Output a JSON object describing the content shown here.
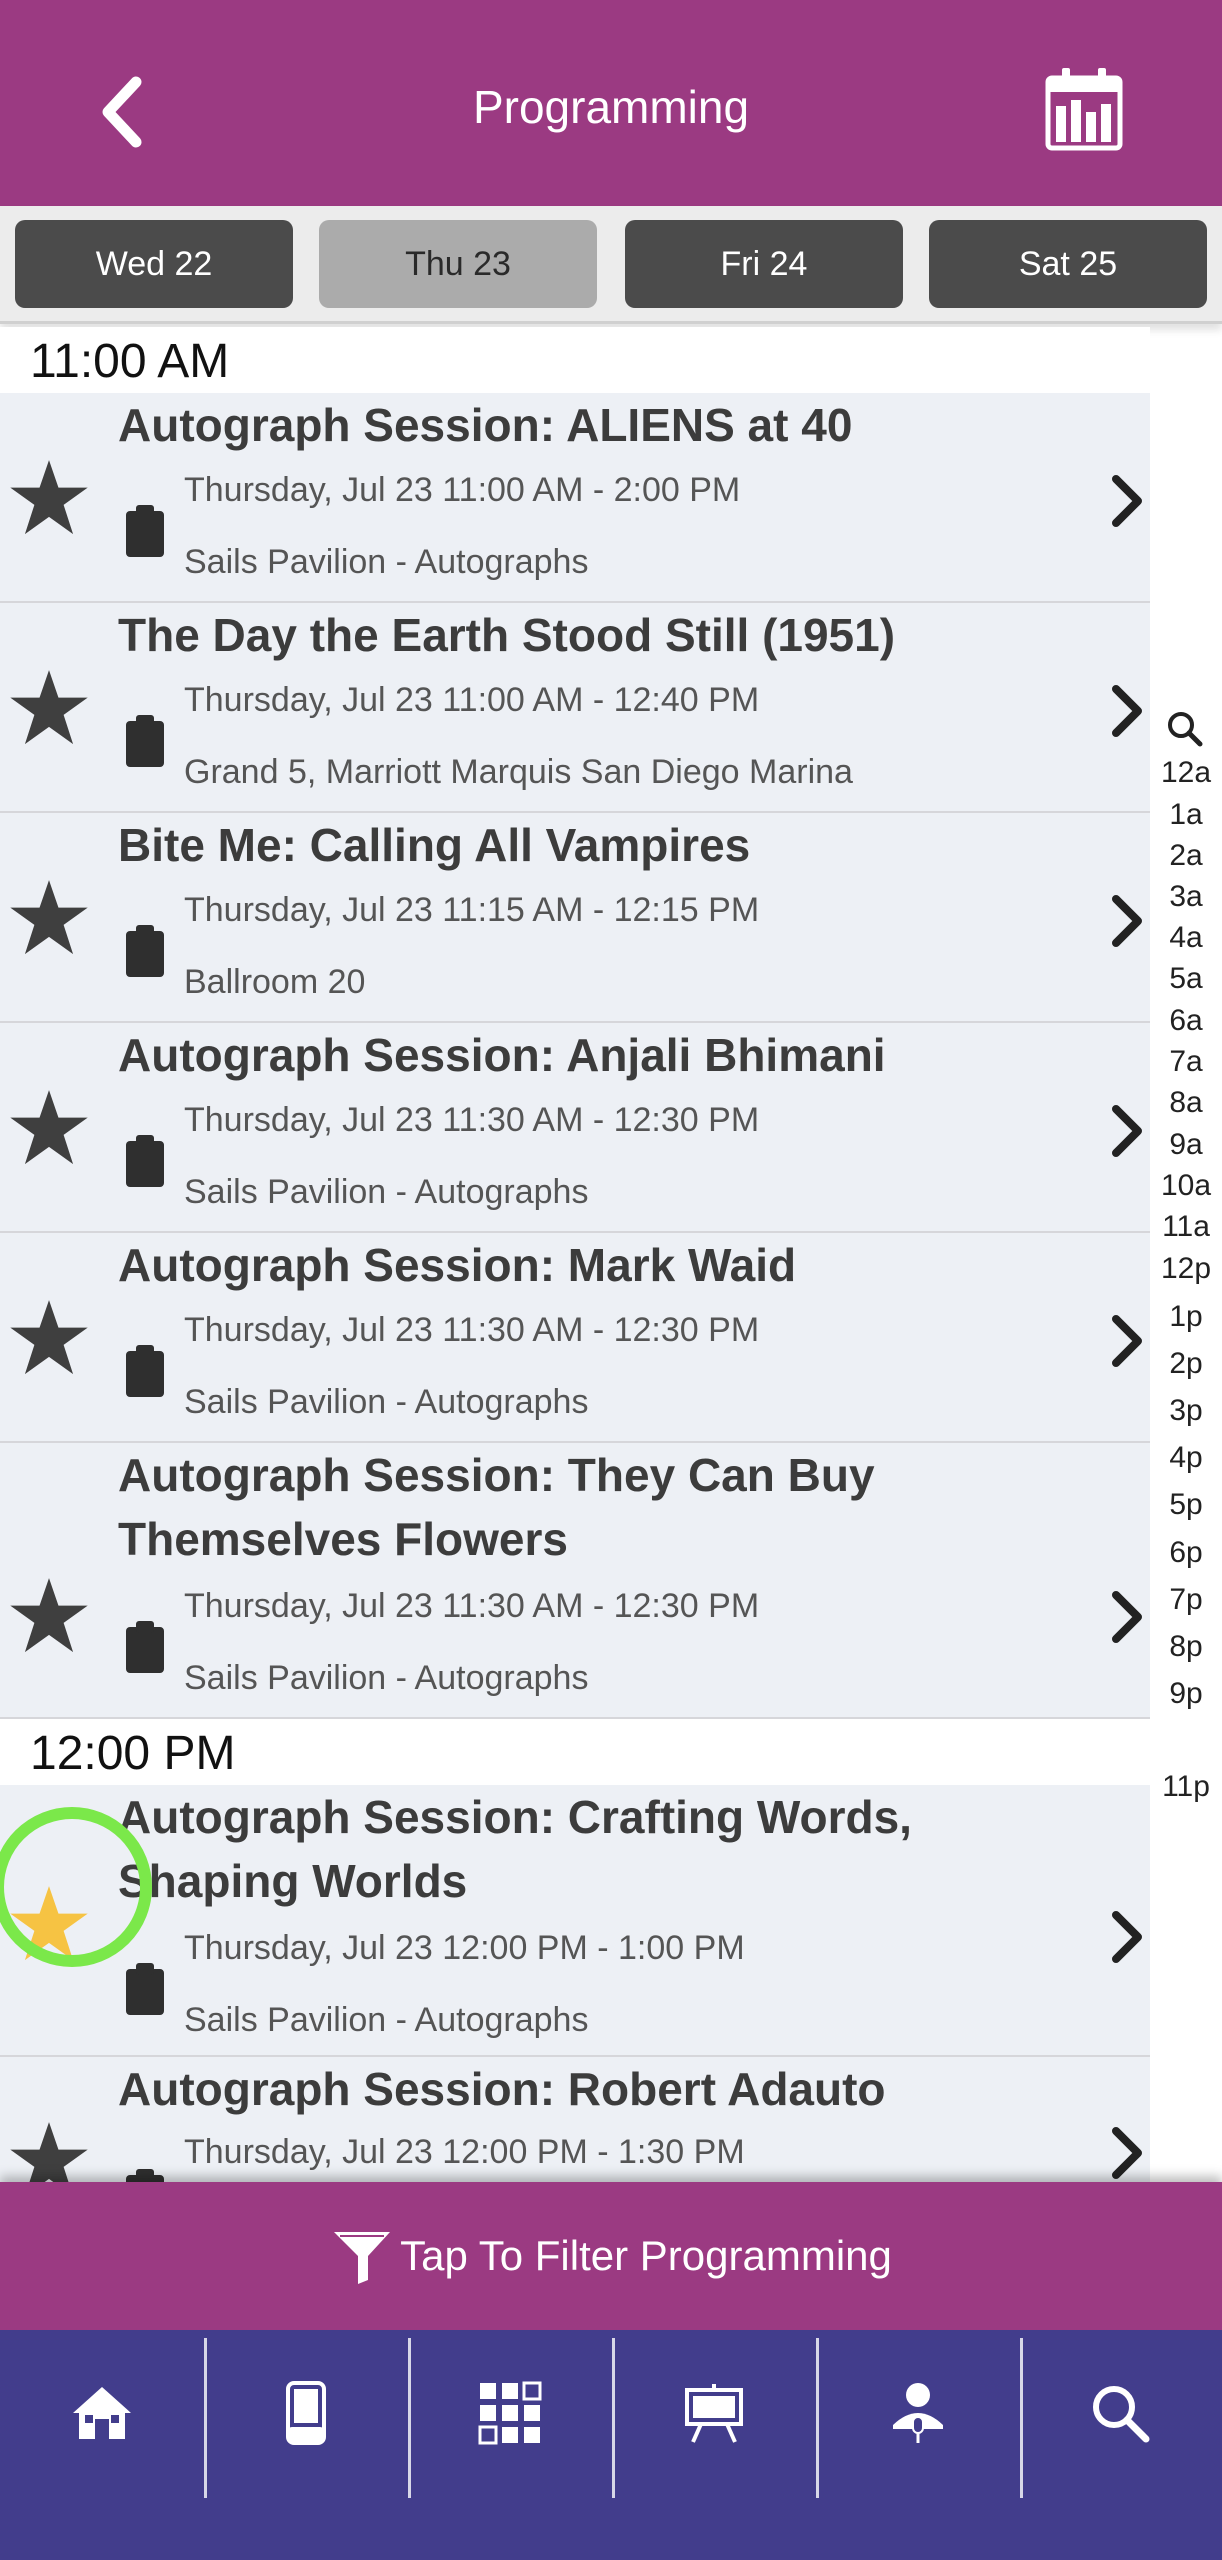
{
  "header": {
    "title": "Programming"
  },
  "days": [
    "Wed 22",
    "Thu 23",
    "Fri 24",
    "Sat 25"
  ],
  "active_day": "Thu 23",
  "groups": [
    {
      "time": "11:00 AM"
    },
    {
      "time": "12:00 PM"
    }
  ],
  "items": [
    {
      "title": "Autograph Session: ALIENS at 40",
      "time": "Thursday, Jul 23 11:00 AM - 2:00 PM",
      "location": "Sails Pavilion - Autographs",
      "favorited": false
    },
    {
      "title": "The Day the Earth Stood Still (1951)",
      "time": "Thursday, Jul 23 11:00 AM - 12:40 PM",
      "location": "Grand 5, Marriott Marquis San Diego Marina",
      "favorited": false
    },
    {
      "title": "Bite Me: Calling All Vampires",
      "time": "Thursday, Jul 23 11:15 AM - 12:15 PM",
      "location": "Ballroom 20",
      "favorited": false
    },
    {
      "title": "Autograph Session: Anjali Bhimani",
      "time": "Thursday, Jul 23 11:30 AM - 12:30 PM",
      "location": "Sails Pavilion - Autographs",
      "favorited": false
    },
    {
      "title": "Autograph Session: Mark Waid",
      "time": "Thursday, Jul 23 11:30 AM - 12:30 PM",
      "location": "Sails Pavilion - Autographs",
      "favorited": false
    },
    {
      "title": "Autograph Session: They Can Buy Themselves Flowers",
      "time": "Thursday, Jul 23 11:30 AM - 12:30 PM",
      "location": "Sails Pavilion - Autographs",
      "favorited": false
    },
    {
      "title": "Autograph Session: Crafting Words, Shaping Worlds",
      "time": "Thursday, Jul 23 12:00 PM - 1:00 PM",
      "location": "Sails Pavilion - Autographs",
      "favorited": true
    },
    {
      "title": "Autograph Session: Robert Adauto",
      "time": "Thursday, Jul 23 12:00 PM - 1:30 PM",
      "location": "",
      "favorited": false
    }
  ],
  "time_index": [
    "12a",
    "1a",
    "2a",
    "3a",
    "4a",
    "5a",
    "6a",
    "7a",
    "8a",
    "9a",
    "10a",
    "11a",
    "12p",
    "1p",
    "2p",
    "3p",
    "4p",
    "5p",
    "6p",
    "7p",
    "8p",
    "9p",
    "11p"
  ],
  "filter": {
    "label": "Tap To Filter Programming"
  },
  "nav": [
    "home-icon",
    "phone-icon",
    "grid-icon",
    "presentation-icon",
    "speaker-icon",
    "search-icon"
  ],
  "colors": {
    "header": "#9b3a82",
    "nav": "#423d8c",
    "star_active": "#f6c343",
    "star_inactive": "#3f3f3f",
    "highlight": "#7be84a"
  }
}
